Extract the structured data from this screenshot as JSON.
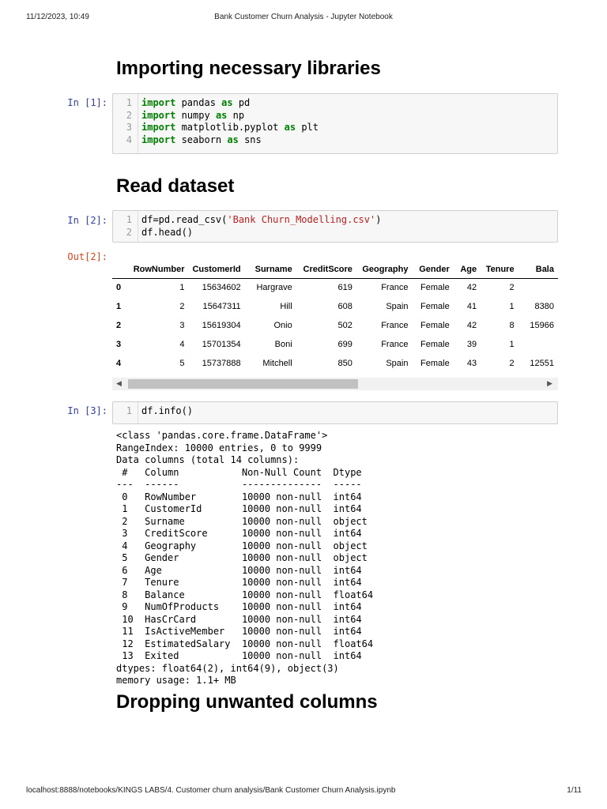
{
  "header": {
    "datetime": "11/12/2023, 10:49",
    "title": "Bank Customer Churn Analysis - Jupyter Notebook"
  },
  "footer": {
    "url": "localhost:8888/notebooks/KINGS LABS/4. Customer churn analysis/Bank Customer Churn Analysis.ipynb",
    "page": "1/11"
  },
  "headings": [
    "Importing necessary libraries",
    "Read dataset",
    "Dropping unwanted columns"
  ],
  "cells": [
    {
      "prompt": "In [1]:",
      "lines": [
        [
          {
            "t": "import",
            "c": "kw"
          },
          {
            "t": " pandas "
          },
          {
            "t": "as",
            "c": "kw"
          },
          {
            "t": " pd"
          }
        ],
        [
          {
            "t": "import",
            "c": "kw"
          },
          {
            "t": " numpy "
          },
          {
            "t": "as",
            "c": "kw"
          },
          {
            "t": " np"
          }
        ],
        [
          {
            "t": "import",
            "c": "kw"
          },
          {
            "t": " matplotlib.pyplot "
          },
          {
            "t": "as",
            "c": "kw"
          },
          {
            "t": " plt"
          }
        ],
        [
          {
            "t": "import",
            "c": "kw"
          },
          {
            "t": " seaborn "
          },
          {
            "t": "as",
            "c": "kw"
          },
          {
            "t": " sns"
          }
        ]
      ]
    },
    {
      "prompt": "In [2]:",
      "lines": [
        [
          {
            "t": "df=pd.read_csv("
          },
          {
            "t": "'Bank Churn_Modelling.csv'",
            "c": "st"
          },
          {
            "t": ")"
          }
        ],
        [
          {
            "t": "df.head()"
          }
        ]
      ]
    },
    {
      "prompt": "In [3]:",
      "lines": [
        [
          {
            "t": "df.info()"
          }
        ]
      ]
    }
  ],
  "out2": {
    "prompt": "Out[2]:",
    "columns": [
      "",
      "RowNumber",
      "CustomerId",
      "Surname",
      "CreditScore",
      "Geography",
      "Gender",
      "Age",
      "Tenure",
      "Bala"
    ],
    "rows": [
      [
        "0",
        "1",
        "15634602",
        "Hargrave",
        "619",
        "France",
        "Female",
        "42",
        "2",
        ""
      ],
      [
        "1",
        "2",
        "15647311",
        "Hill",
        "608",
        "Spain",
        "Female",
        "41",
        "1",
        "8380"
      ],
      [
        "2",
        "3",
        "15619304",
        "Onio",
        "502",
        "France",
        "Female",
        "42",
        "8",
        "15966"
      ],
      [
        "3",
        "4",
        "15701354",
        "Boni",
        "699",
        "France",
        "Female",
        "39",
        "1",
        ""
      ],
      [
        "4",
        "5",
        "15737888",
        "Mitchell",
        "850",
        "Spain",
        "Female",
        "43",
        "2",
        "12551"
      ]
    ]
  },
  "out3": [
    "<class 'pandas.core.frame.DataFrame'>",
    "RangeIndex: 10000 entries, 0 to 9999",
    "Data columns (total 14 columns):",
    " #   Column           Non-Null Count  Dtype  ",
    "---  ------           --------------  -----  ",
    " 0   RowNumber        10000 non-null  int64  ",
    " 1   CustomerId       10000 non-null  int64  ",
    " 2   Surname          10000 non-null  object ",
    " 3   CreditScore      10000 non-null  int64  ",
    " 4   Geography        10000 non-null  object ",
    " 5   Gender           10000 non-null  object ",
    " 6   Age              10000 non-null  int64  ",
    " 7   Tenure           10000 non-null  int64  ",
    " 8   Balance          10000 non-null  float64",
    " 9   NumOfProducts    10000 non-null  int64  ",
    " 10  HasCrCard        10000 non-null  int64  ",
    " 11  IsActiveMember   10000 non-null  int64  ",
    " 12  EstimatedSalary  10000 non-null  float64",
    " 13  Exited           10000 non-null  int64  ",
    "dtypes: float64(2), int64(9), object(3)",
    "memory usage: 1.1+ MB"
  ]
}
